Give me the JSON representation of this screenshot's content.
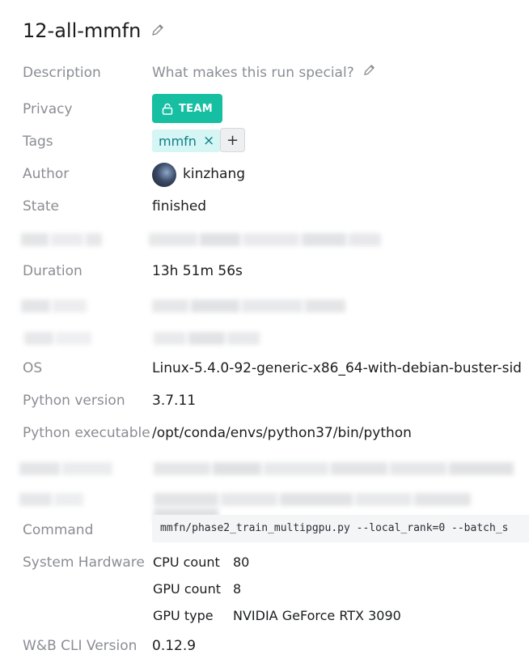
{
  "run": {
    "name": "12-all-mmfn"
  },
  "fields": {
    "description": {
      "label": "Description",
      "placeholder": "What makes this run special?"
    },
    "privacy": {
      "label": "Privacy",
      "button": "TEAM"
    },
    "tags": {
      "label": "Tags",
      "items": [
        "mmfn"
      ],
      "remove_glyph": "×",
      "add_glyph": "+"
    },
    "author": {
      "label": "Author",
      "name": "kinzhang"
    },
    "state": {
      "label": "State",
      "value": "finished"
    },
    "duration": {
      "label": "Duration",
      "value": "13h 51m 56s"
    },
    "os": {
      "label": "OS",
      "value": "Linux-5.4.0-92-generic-x86_64-with-debian-buster-sid"
    },
    "python_version": {
      "label": "Python version",
      "value": "3.7.11"
    },
    "python_executable": {
      "label": "Python executable",
      "value": "/opt/conda/envs/python37/bin/python"
    },
    "command": {
      "label": "Command",
      "value": "mmfn/phase2_train_multipgpu.py --local_rank=0 --batch_s"
    },
    "system_hardware": {
      "label": "System Hardware",
      "rows": [
        {
          "key": "CPU count",
          "value": "80"
        },
        {
          "key": "GPU count",
          "value": "8"
        },
        {
          "key": "GPU type",
          "value": "NVIDIA GeForce RTX 3090"
        }
      ]
    },
    "cli_version": {
      "label": "W&B CLI Version",
      "value": "0.12.9"
    }
  },
  "icons": {
    "edit": "pencil-icon",
    "lock": "lock-icon",
    "close": "close-icon",
    "add": "plus-icon"
  },
  "colors": {
    "accent": "#16bfa1",
    "tag_bg": "#d6f5f5",
    "tag_text": "#0c7f86",
    "label": "#8a8d93"
  }
}
